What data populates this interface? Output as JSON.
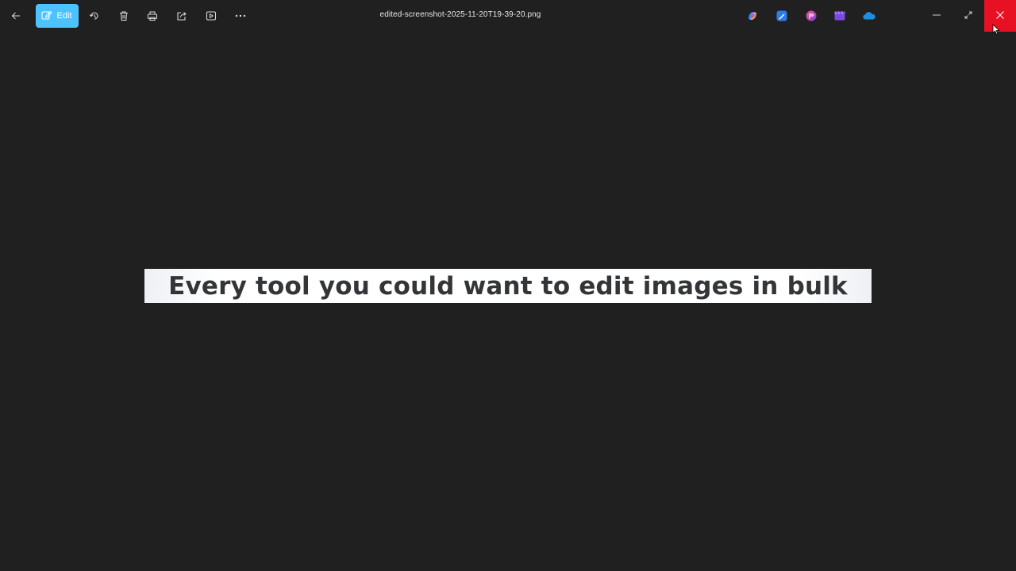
{
  "toolbar": {
    "edit_label": "Edit",
    "back_icon": "back-arrow-icon",
    "rotate_icon": "rotate-icon",
    "delete_icon": "trash-icon",
    "print_icon": "print-icon",
    "share_icon": "share-icon",
    "slideshow_icon": "slideshow-icon",
    "more_icon": "more-icon"
  },
  "file": {
    "name": "edited-screenshot-2025-11-20T19-39-20.png"
  },
  "apps": [
    {
      "name": "copilot-icon"
    },
    {
      "name": "designer-icon"
    },
    {
      "name": "clipchamp-icon"
    },
    {
      "name": "video-editor-icon"
    },
    {
      "name": "onedrive-icon"
    }
  ],
  "window_controls": {
    "minimize_icon": "minimize-icon",
    "restore_icon": "restore-icon",
    "close_icon": "close-icon"
  },
  "image": {
    "text": "Every tool you could want to edit images in bulk"
  },
  "colors": {
    "background": "#202020",
    "accent": "#4cc2ff",
    "close_hover": "#e81123",
    "banner_text": "#333538"
  }
}
